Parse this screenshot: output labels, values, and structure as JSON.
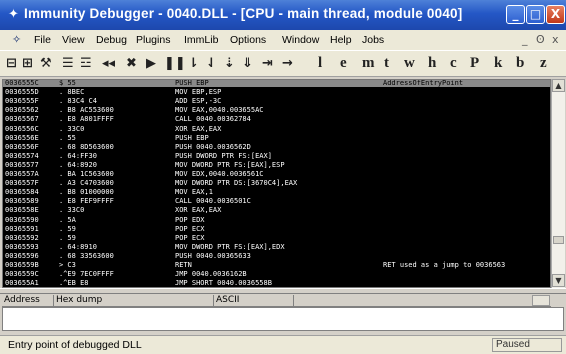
{
  "window": {
    "title": "Immunity Debugger - 0040.DLL - [CPU - main thread, module 0040]",
    "controls": {
      "minimize": "_",
      "maximize": "□",
      "close": "X"
    }
  },
  "menu": {
    "items": [
      "File",
      "View",
      "Debug",
      "Plugins",
      "ImmLib",
      "Options",
      "Window",
      "Help",
      "Jobs"
    ],
    "mdi_controls": [
      "_",
      "ʘ",
      "x"
    ]
  },
  "toolbar": {
    "icons": [
      "open-icon",
      "restart-icon",
      "close-icon",
      "settings-icon",
      "log-icon",
      "rewind-icon",
      "stop-icon",
      "run-icon",
      "pause-icon",
      "step-into-icon",
      "step-over-icon",
      "trace-into-icon",
      "trace-over-icon",
      "execute-till-return-icon",
      "go-to-icon"
    ],
    "glyphs": [
      "⊟",
      "⊞",
      "⚒",
      "☰",
      "☲",
      "◂◂",
      "✖",
      "▶",
      "❚❚",
      "⇂",
      "⇃",
      "⇣",
      "⇓",
      "⇥",
      "→"
    ],
    "letters": [
      "l",
      "e",
      "m",
      "t",
      "w",
      "h",
      "c",
      "P",
      "k",
      "b",
      "z"
    ]
  },
  "cpu": {
    "rows": [
      {
        "addr": "0036555C",
        "hex": "$ 55",
        "dis": "PUSH EBP",
        "comment": "AddressOfEntryPoint"
      },
      {
        "addr": "0036555D",
        "hex": ". 8BEC",
        "dis": "MOV EBP,ESP",
        "comment": ""
      },
      {
        "addr": "0036555F",
        "hex": ". 83C4 C4",
        "dis": "ADD ESP,-3C",
        "comment": ""
      },
      {
        "addr": "00365562",
        "hex": ". B8 AC553600",
        "dis": "MOV EAX,0040.003655AC",
        "comment": ""
      },
      {
        "addr": "00365567",
        "hex": ". E8 A801FFFF",
        "dis": "CALL 0040.00362784",
        "comment": ""
      },
      {
        "addr": "0036556C",
        "hex": ". 33C0",
        "dis": "XOR EAX,EAX",
        "comment": ""
      },
      {
        "addr": "0036556E",
        "hex": ". 55",
        "dis": "PUSH EBP",
        "comment": ""
      },
      {
        "addr": "0036556F",
        "hex": ". 68 8D563600",
        "dis": "PUSH 0040.0036562D",
        "comment": ""
      },
      {
        "addr": "00365574",
        "hex": ". 64:FF30",
        "dis": "PUSH DWORD PTR FS:[EAX]",
        "comment": ""
      },
      {
        "addr": "00365577",
        "hex": ". 64:8920",
        "dis": "MOV DWORD PTR FS:[EAX],ESP",
        "comment": ""
      },
      {
        "addr": "0036557A",
        "hex": ". BA 1C563600",
        "dis": "MOV EDX,0040.0036561C",
        "comment": ""
      },
      {
        "addr": "0036557F",
        "hex": ". A3 C4703600",
        "dis": "MOV DWORD PTR DS:[3670C4],EAX",
        "comment": ""
      },
      {
        "addr": "00365584",
        "hex": ". B8 01000000",
        "dis": "MOV EAX,1",
        "comment": ""
      },
      {
        "addr": "00365589",
        "hex": ". E8 FEF9FFFF",
        "dis": "CALL 0040.0036501C",
        "comment": ""
      },
      {
        "addr": "0036558E",
        "hex": ". 33C0",
        "dis": "XOR EAX,EAX",
        "comment": ""
      },
      {
        "addr": "00365590",
        "hex": ". 5A",
        "dis": "POP EDX",
        "comment": ""
      },
      {
        "addr": "00365591",
        "hex": ". 59",
        "dis": "POP ECX",
        "comment": ""
      },
      {
        "addr": "00365592",
        "hex": ". 59",
        "dis": "POP ECX",
        "comment": ""
      },
      {
        "addr": "00365593",
        "hex": ". 64:8910",
        "dis": "MOV DWORD PTR FS:[EAX],EDX",
        "comment": ""
      },
      {
        "addr": "00365596",
        "hex": ". 68 33563600",
        "dis": "PUSH 0040.00365633",
        "comment": ""
      },
      {
        "addr": "0036559B",
        "hex": "> C3",
        "dis": "RETN",
        "comment": "RET used as a jump to 0036563"
      },
      {
        "addr": "0036559C",
        "hex": ".^E9 7EC0FFFF",
        "dis": "JMP 0040.0036162B",
        "comment": ""
      },
      {
        "addr": "003655A1",
        "hex": ".^EB E8",
        "dis": "JMP SHORT 0040.0036558B",
        "comment": ""
      }
    ]
  },
  "dump": {
    "columns": [
      "Address",
      "Hex dump",
      "ASCII"
    ]
  },
  "status": {
    "message": "Entry point of debugged DLL",
    "state": "Paused"
  }
}
